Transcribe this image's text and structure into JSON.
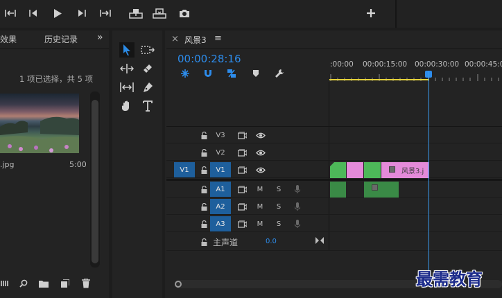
{
  "colors": {
    "accent": "#2d8ceb",
    "clip_green": "#4db859",
    "clip_pink": "#e48ad9",
    "audio_green": "#3a8a46",
    "track_blue": "#1e5f9c",
    "work_area": "#e6d23a"
  },
  "topbar": {
    "icons": [
      "mark-in-icon",
      "step-back-icon",
      "play-icon",
      "step-forward-icon",
      "mark-out-icon",
      "insert-icon",
      "overwrite-icon",
      "camera-icon",
      "add-icon"
    ]
  },
  "left_panel": {
    "tab_effects": "效果",
    "tab_history": "历史记录",
    "overflow": "»",
    "selection_status": "1 项已选择，共 5 项",
    "item_name": ".jpg",
    "item_duration": "5:00"
  },
  "timeline": {
    "close": "×",
    "sequence_name": "风景3",
    "menu": "≡",
    "timecode": "00:00:28:16",
    "ruler_labels": [
      ":00:00",
      "00:00:15:00",
      "00:00:30:00",
      "00:00:45:0"
    ],
    "tracks": {
      "v3": "V3",
      "v2": "V2",
      "v1": "V1",
      "v1_src": "V1",
      "a1": "A1",
      "a2": "A2",
      "a3": "A3",
      "m": "M",
      "s": "S",
      "master_label": "主声道",
      "master_value": "0.0"
    },
    "clip_label": "风景3.j"
  },
  "watermark": "最需教育"
}
